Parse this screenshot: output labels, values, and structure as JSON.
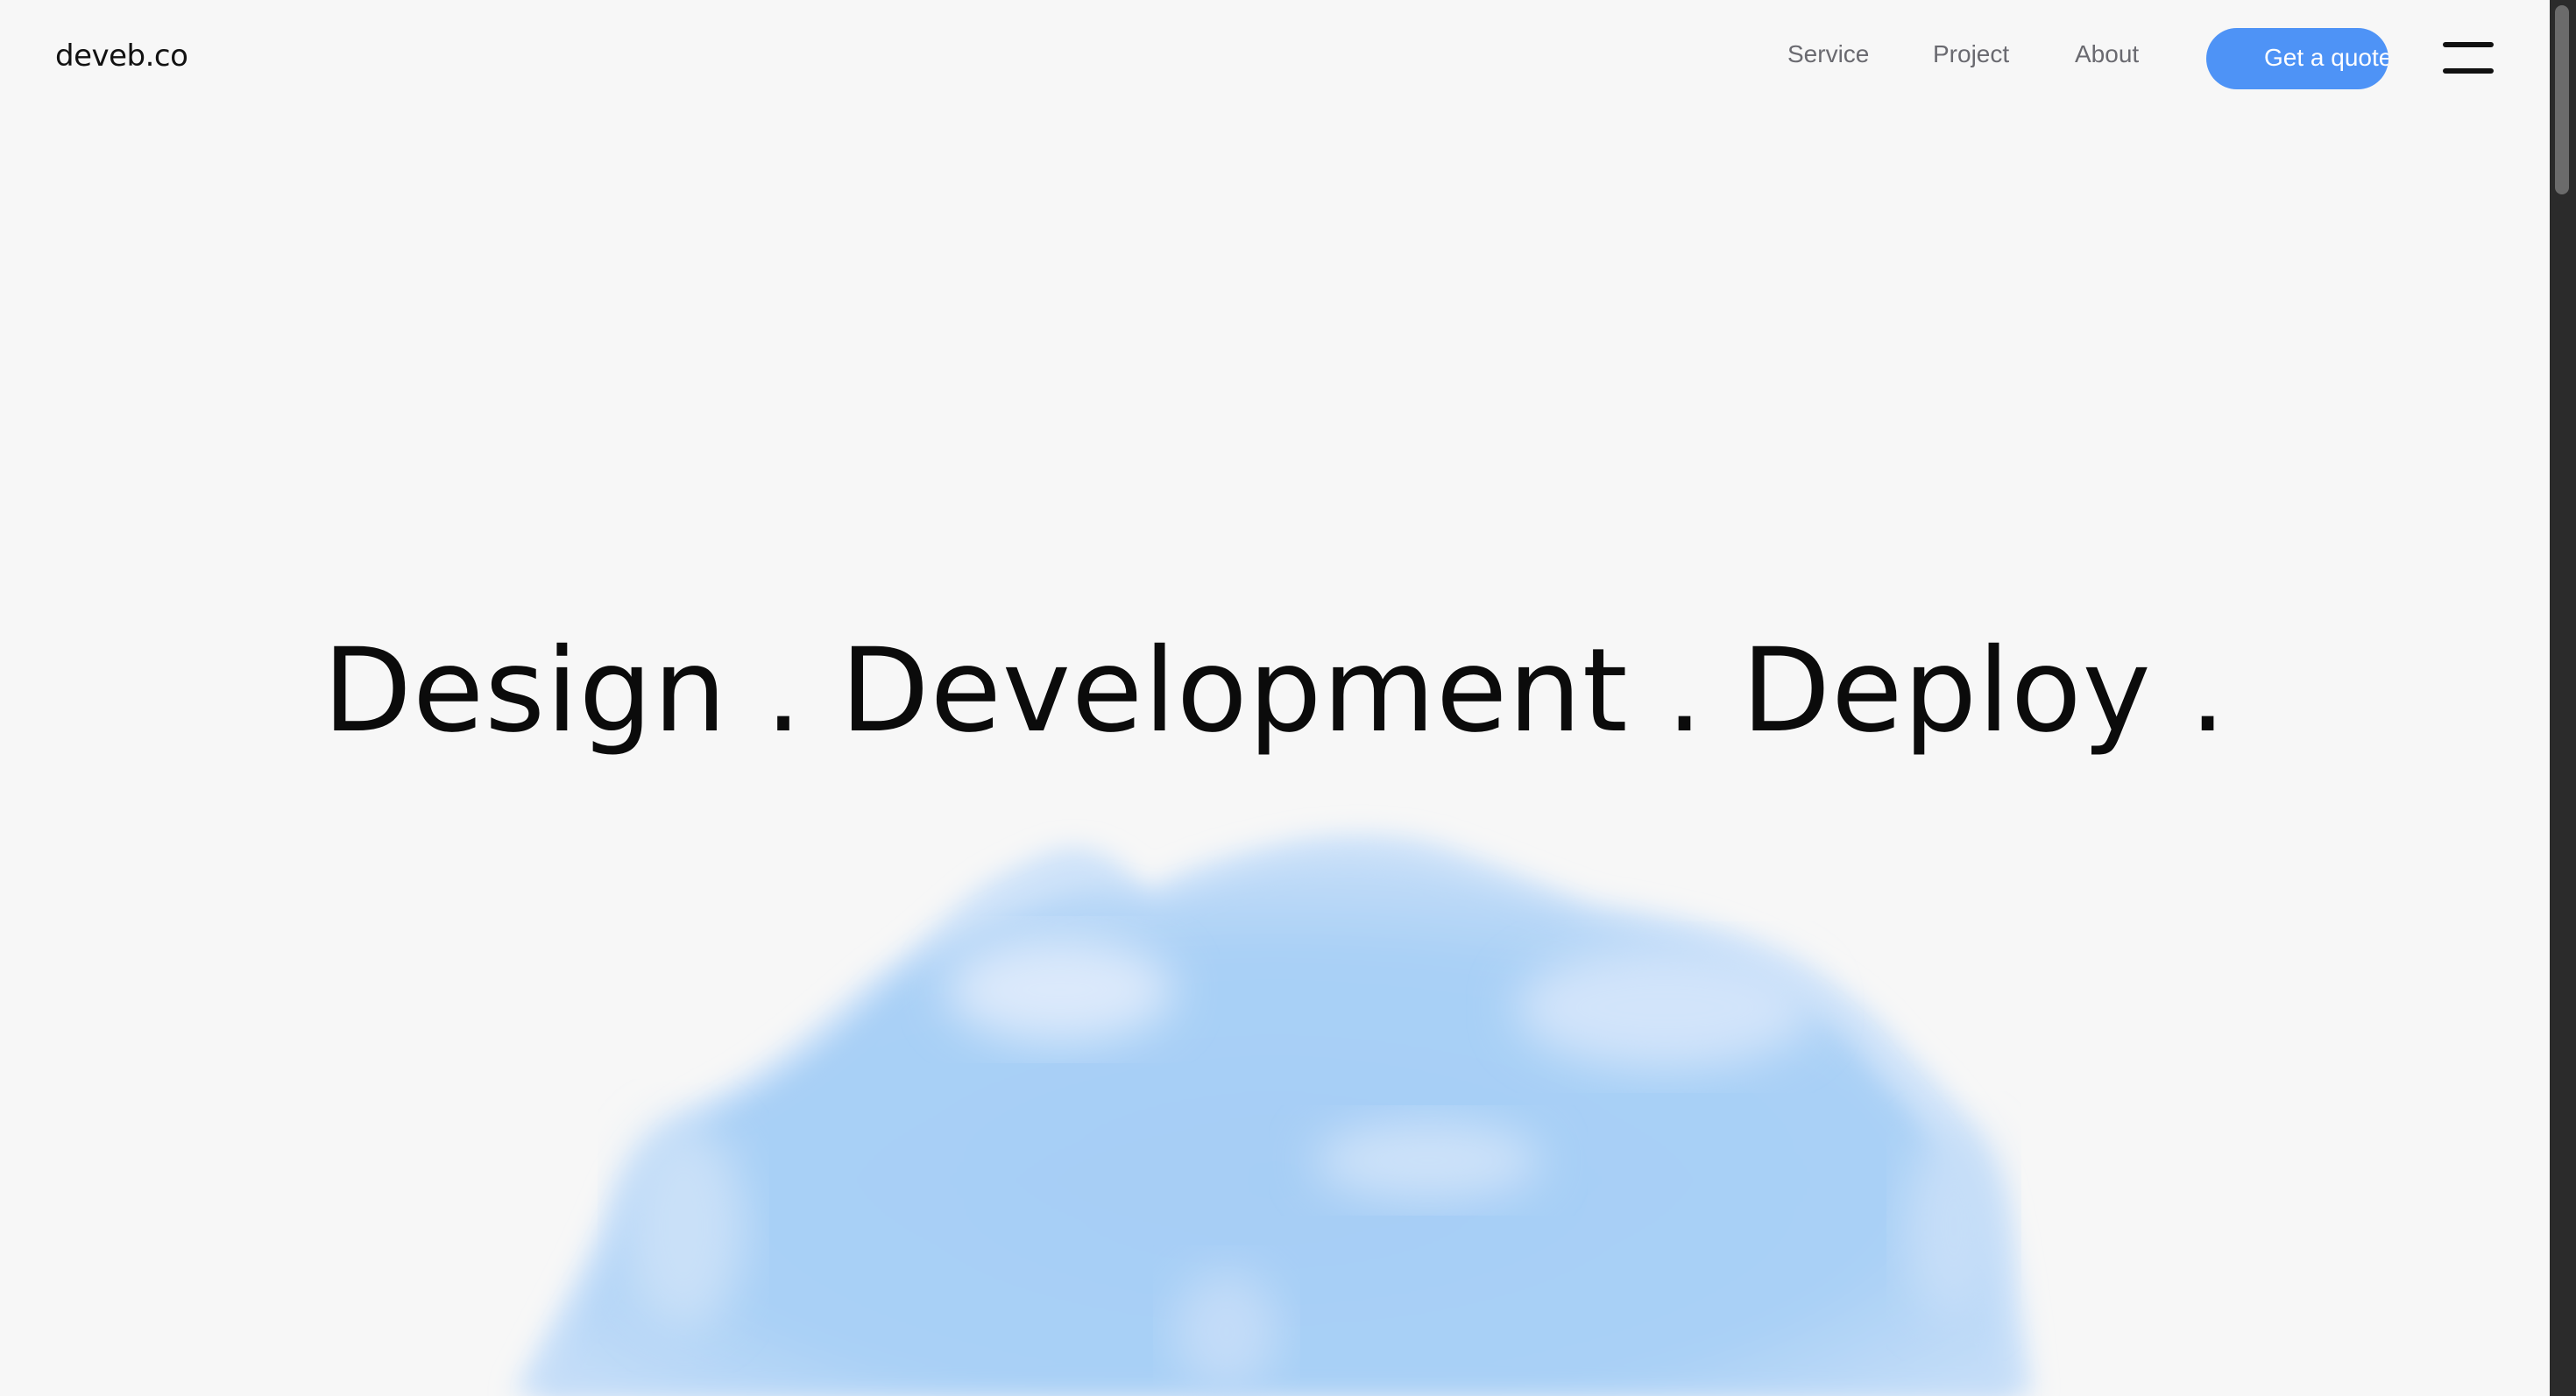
{
  "brand": {
    "logo_text": "deveb.co"
  },
  "nav": {
    "links": [
      "Service",
      "Project",
      "About"
    ],
    "cta_label": "Get a quote",
    "menu_icon": "hamburger-menu-icon"
  },
  "hero": {
    "title": "Design . Development . Deploy ."
  },
  "colors": {
    "background": "#f7f7f7",
    "accent": "#4e93f6",
    "blob": "#a8cff5",
    "text": "#0b0b0b"
  }
}
